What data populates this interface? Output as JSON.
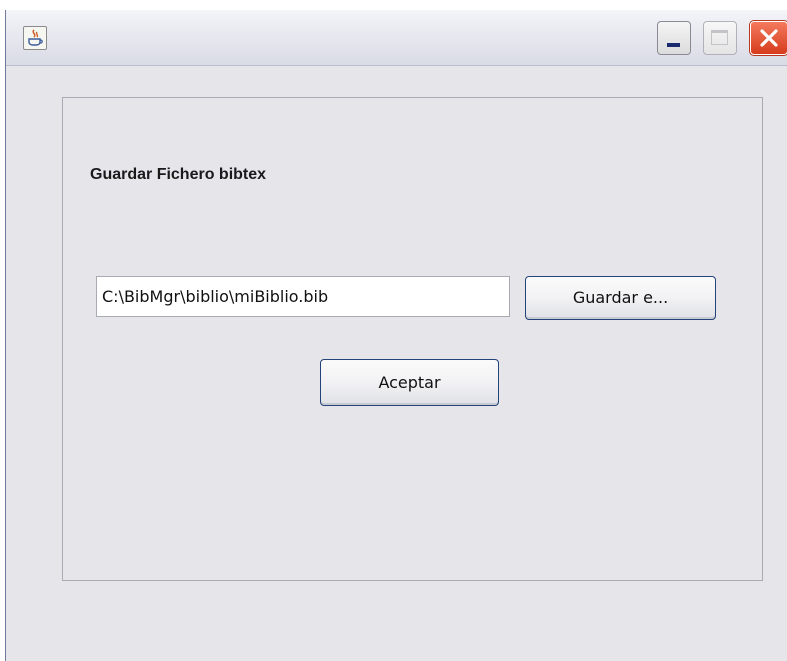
{
  "window": {
    "title": "",
    "icons": {
      "app": "java-icon",
      "minimize": "minimize-icon",
      "maximize": "maximize-icon",
      "close": "close-icon"
    }
  },
  "panel": {
    "heading": "Guardar Fichero bibtex",
    "file_path_value": "C:\\BibMgr\\biblio\\miBiblio.bib",
    "save_as_button_label": "Guardar e...",
    "accept_button_label": "Aceptar"
  },
  "colors": {
    "window_bg": "#e6e5ea",
    "button_border": "#24437a",
    "close_button": "#d63b1d"
  }
}
